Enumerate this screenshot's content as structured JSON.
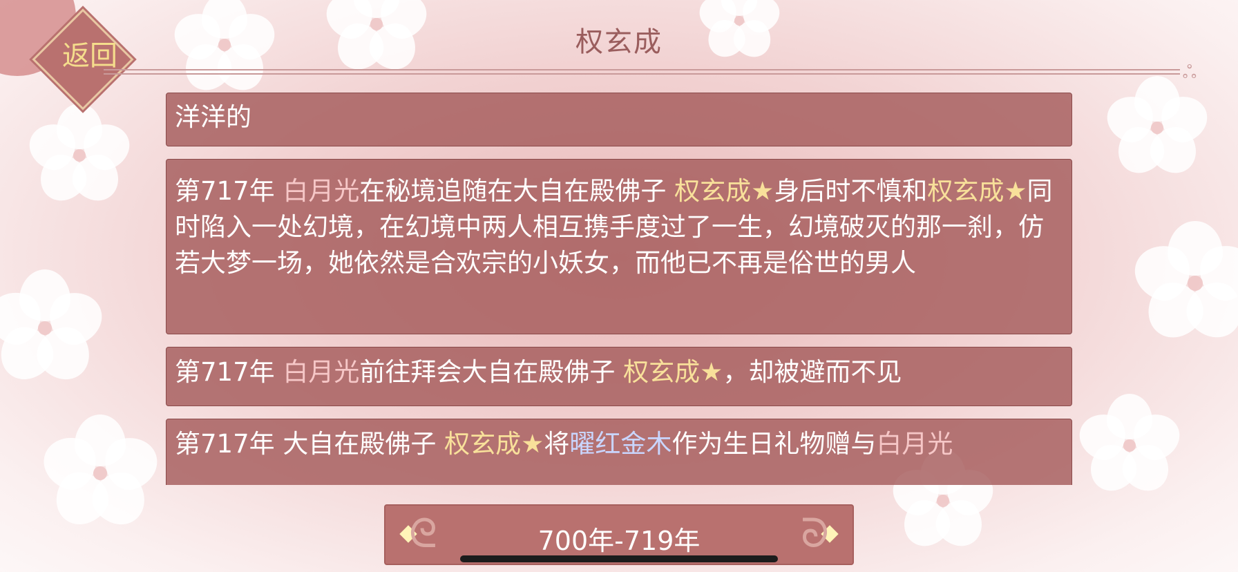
{
  "header": {
    "title": "权玄成",
    "back_label": "返回"
  },
  "entries": [
    {
      "segments": [
        {
          "text": "洋洋的",
          "style": "plain"
        }
      ]
    },
    {
      "segments": [
        {
          "text": "第717年 ",
          "style": "plain"
        },
        {
          "text": "白月光",
          "style": "self"
        },
        {
          "text": "在秘境追随在大自在殿佛子 ",
          "style": "plain"
        },
        {
          "text": "权玄成★",
          "style": "name"
        },
        {
          "text": "身后时不慎和",
          "style": "plain"
        },
        {
          "text": "权玄成★",
          "style": "name"
        },
        {
          "text": "同时陷入一处幻境，在幻境中两人相互携手度过了一生，幻境破灭的那一刹，仿若大梦一场，她依然是合欢宗的小妖女，而他已不再是俗世的男人",
          "style": "plain"
        }
      ]
    },
    {
      "segments": [
        {
          "text": "第717年 ",
          "style": "plain"
        },
        {
          "text": "白月光",
          "style": "self"
        },
        {
          "text": "前往拜会大自在殿佛子 ",
          "style": "plain"
        },
        {
          "text": "权玄成★",
          "style": "name"
        },
        {
          "text": "，却被避而不见",
          "style": "plain"
        }
      ]
    },
    {
      "segments": [
        {
          "text": "第717年 大自在殿佛子 ",
          "style": "plain"
        },
        {
          "text": "权玄成★",
          "style": "name"
        },
        {
          "text": "将",
          "style": "plain"
        },
        {
          "text": "曜红金木",
          "style": "item"
        },
        {
          "text": "作为生日礼物赠与",
          "style": "plain"
        },
        {
          "text": "白月光",
          "style": "self"
        }
      ]
    }
  ],
  "pager": {
    "label": "700年-719年"
  },
  "colors": {
    "card": "#a55c5c",
    "name": "#f8e09a",
    "self": "#f6c7c7",
    "item": "#c9d6ff"
  }
}
